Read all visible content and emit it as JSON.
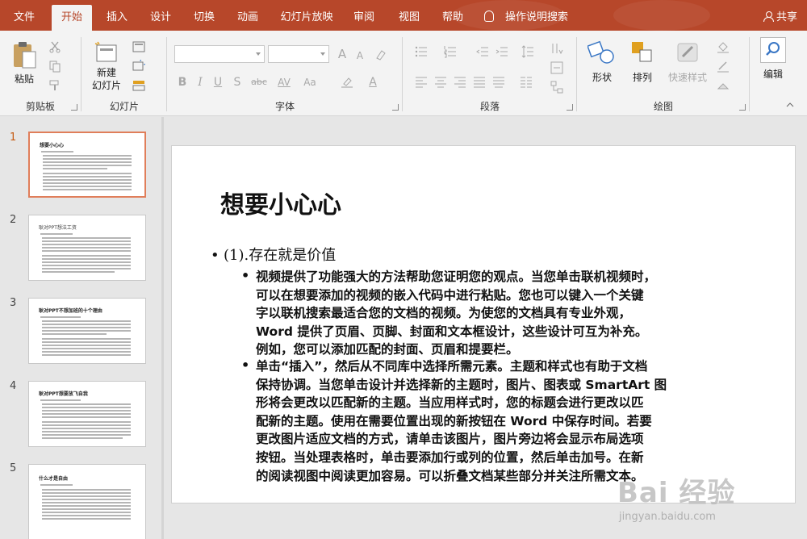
{
  "tabs": [
    {
      "label": "文件",
      "active": false
    },
    {
      "label": "开始",
      "active": true
    },
    {
      "label": "插入",
      "active": false
    },
    {
      "label": "设计",
      "active": false
    },
    {
      "label": "切换",
      "active": false
    },
    {
      "label": "动画",
      "active": false
    },
    {
      "label": "幻灯片放映",
      "active": false
    },
    {
      "label": "审阅",
      "active": false
    },
    {
      "label": "视图",
      "active": false
    },
    {
      "label": "帮助",
      "active": false
    }
  ],
  "tell_me": "操作说明搜索",
  "share": "共享",
  "ribbon": {
    "clipboard": {
      "paste": "粘贴",
      "label": "剪贴板"
    },
    "slides": {
      "new_slide_line1": "新建",
      "new_slide_line2": "幻灯片",
      "label": "幻灯片"
    },
    "font": {
      "label": "字体",
      "bold": "B",
      "italic": "I",
      "underline": "U",
      "shadow": "S",
      "strike": "abc",
      "spacing": "AV",
      "case": "Aa",
      "grow": "A",
      "shrink": "A"
    },
    "paragraph": {
      "label": "段落"
    },
    "drawing": {
      "shapes": "形状",
      "arrange": "排列",
      "quick_styles": "快速样式",
      "label": "绘图"
    },
    "editing": {
      "label": "编辑"
    }
  },
  "thumbnails": [
    {
      "num": "1",
      "title": "想要小心心",
      "selected": true
    },
    {
      "num": "2",
      "title": "耿对PPT想法工资",
      "selected": false
    },
    {
      "num": "3",
      "title": "耿对PPT不想加班的十个理由",
      "selected": false
    },
    {
      "num": "4",
      "title": "耿对PPT想要放飞自我",
      "selected": false
    },
    {
      "num": "5",
      "title": "什么才是自由",
      "selected": false
    }
  ],
  "slide": {
    "title": "想要小心心",
    "level1": "(1).存在就是价值",
    "bullet1_lines": [
      "视频提供了功能强大的方法帮助您证明您的观点。当您单击联机视频时，",
      "可以在想要添加的视频的嵌入代码中进行粘贴。您也可以键入一个关键",
      "字以联机搜索最适合您的文档的视频。为使您的文档具有专业外观，",
      "Word 提供了页眉、页脚、封面和文本框设计，这些设计可互为补充。",
      "例如，您可以添加匹配的封面、页眉和提要栏。"
    ],
    "bullet2_lines": [
      "单击“插入”，然后从不同库中选择所需元素。主题和样式也有助于文档",
      "保持协调。当您单击设计并选择新的主题时，图片、图表或 SmartArt 图",
      "形将会更改以匹配新的主题。当应用样式时，您的标题会进行更改以匹",
      "配新的主题。使用在需要位置出现的新按钮在 Word 中保存时间。若要",
      "更改图片适应文档的方式，请单击该图片，图片旁边将会显示布局选项",
      "按钮。当处理表格时，单击要添加行或列的位置，然后单击加号。在新",
      "的阅读视图中阅读更加容易。可以折叠文档某些部分并关注所需文本。"
    ]
  },
  "watermark": {
    "brand": "Bai 经验",
    "url": "jingyan.baidu.com"
  }
}
